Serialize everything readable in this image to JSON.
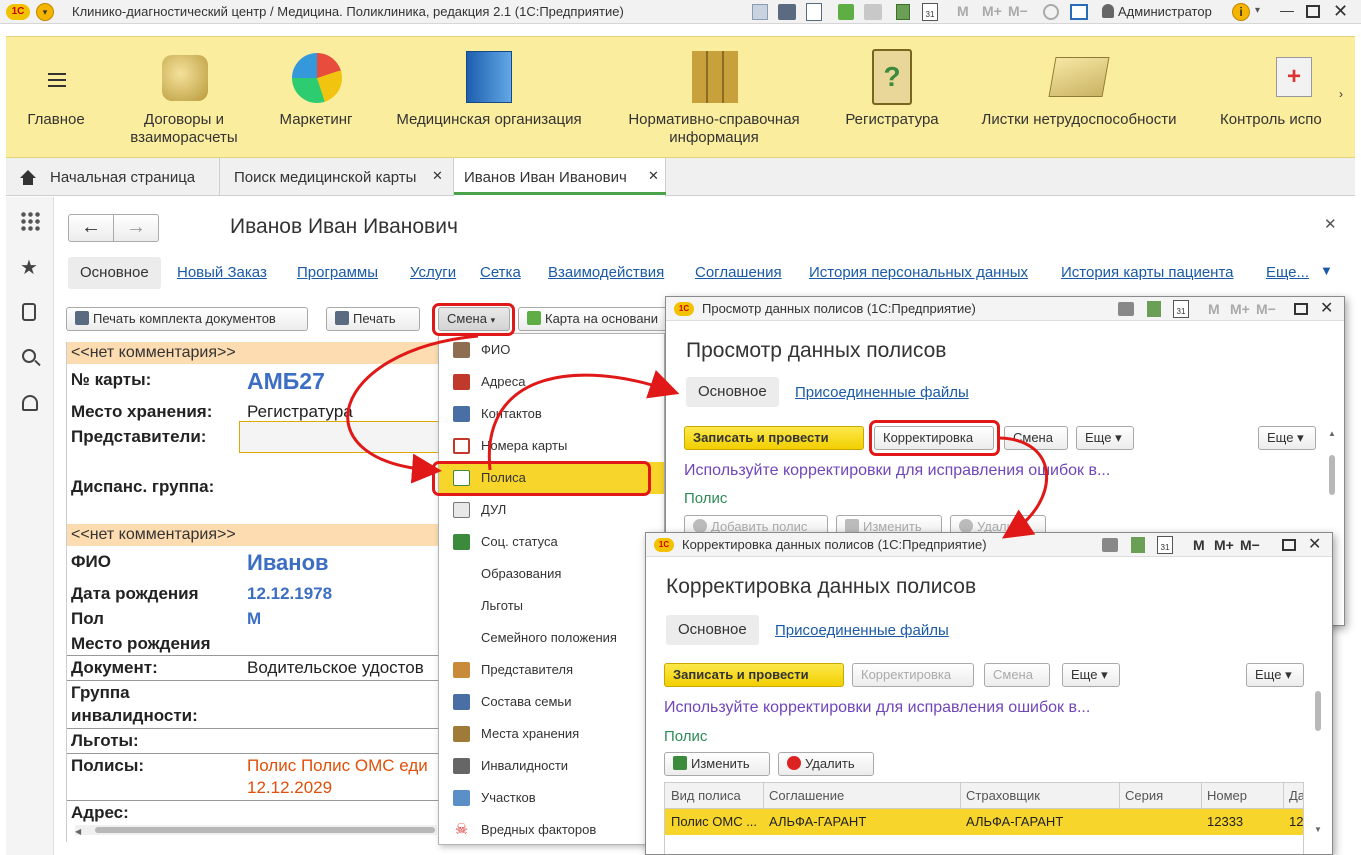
{
  "app": {
    "title": "Клинико-диагностический центр / Медицина. Поликлиника, редакция 2.1  (1С:Предприятие)",
    "user": "Администратор",
    "m_buttons": [
      "M",
      "M+",
      "M−"
    ]
  },
  "sections": [
    {
      "label": "Главное",
      "icon": "hamburger-icon"
    },
    {
      "label": "Договоры и взаиморасчеты",
      "icon": "coins-icon"
    },
    {
      "label": "Маркетинг",
      "icon": "pie-chart-icon"
    },
    {
      "label": "Медицинская организация",
      "icon": "building-icon"
    },
    {
      "label": "Нормативно-справочная информация",
      "icon": "binders-icon"
    },
    {
      "label": "Регистратура",
      "icon": "clipboard-question-icon"
    },
    {
      "label": "Листки нетрудоспособности",
      "icon": "documents-icon"
    },
    {
      "label": "Контроль испо",
      "icon": "first-aid-icon"
    }
  ],
  "open_tabs": [
    {
      "label": "Начальная страница"
    },
    {
      "label": "Поиск медицинской карты"
    },
    {
      "label": "Иванов Иван Иванович"
    }
  ],
  "patient_form": {
    "title": "Иванов Иван Иванович",
    "nav_links": [
      "Основное",
      "Новый Заказ",
      "Программы",
      "Услуги",
      "Сетка",
      "Взаимодействия",
      "Соглашения",
      "История персональных данных",
      "История карты пациента",
      "Еще..."
    ],
    "buttons": {
      "print_set": "Печать комплекта документов",
      "print": "Печать",
      "change": "Смена",
      "card_basis": "Карта на основани"
    },
    "comment_1": "<<нет комментария>>",
    "comment_2": "<<нет комментария>>",
    "fields": {
      "card_no_label": "№ карты:",
      "card_no": "АМБ27",
      "storage_label": "Место хранения:",
      "storage": "Регистратура",
      "reps_label": "Представители:",
      "disp_label": "Диспанс. группа:",
      "fio_label": "ФИО",
      "fio": "Иванов",
      "dob_label": "Дата рождения",
      "dob": "12.12.1978",
      "sex_label": "Пол",
      "sex": "М",
      "pob_label": "Место рождения",
      "doc_label": "Документ:",
      "doc": "Водительское удостов",
      "disab_label_1": "Группа",
      "disab_label_2": "инвалидности:",
      "benefits_label": "Льготы:",
      "policies_label": "Полисы:",
      "policies_1": "Полис Полис ОМС еди",
      "policies_2": "12.12.2029",
      "address_label": "Адрес:"
    }
  },
  "change_menu": [
    "ФИО",
    "Адреса",
    "Контактов",
    "Номера карты",
    "Полиса",
    "ДУЛ",
    "Соц. статуса",
    "Образования",
    "Льготы",
    "Семейного положения",
    "Представителя",
    "Состава семьи",
    "Места хранения",
    "Инвалидности",
    "Участков",
    "Вредных факторов"
  ],
  "view_window": {
    "title": "Просмотр данных полисов  (1С:Предприятие)",
    "heading": "Просмотр данных полисов",
    "tab_main": "Основное",
    "tab_files": "Присоединенные файлы",
    "btn_post": "Записать и провести",
    "btn_correct": "Корректировка",
    "btn_change": "Смена",
    "btn_more": "Еще",
    "btn_more2": "Еще",
    "hint": "Используйте корректировки для исправления ошибок в...",
    "section": "Полис",
    "btn_add": "Добавить полис",
    "btn_edit": "Изменить",
    "btn_delete": "Удалить"
  },
  "correct_window": {
    "title": "Корректировка данных полисов  (1С:Предприятие)",
    "heading": "Корректировка данных полисов",
    "tab_main": "Основное",
    "tab_files": "Присоединенные файлы",
    "btn_post": "Записать и провести",
    "btn_correct": "Корректировка",
    "btn_change": "Смена",
    "btn_more": "Еще",
    "btn_more2": "Еще",
    "hint": "Используйте корректировки для исправления ошибок в...",
    "section": "Полис",
    "btn_edit": "Изменить",
    "btn_delete": "Удалить",
    "table": {
      "columns": [
        "Вид полиса",
        "Соглашение",
        "Страховщик",
        "Серия",
        "Номер",
        "Да"
      ],
      "rows": [
        [
          "Полис ОМС ...",
          "АЛЬФА-ГАРАНТ",
          "АЛЬФА-ГАРАНТ",
          "",
          "12333",
          "12"
        ]
      ]
    }
  },
  "colors": {
    "section_bar": "#fbed9e",
    "accent_yellow": "#f7d52a",
    "annotation_red": "#e01818",
    "link_blue": "#1a5aa6",
    "hint_purple": "#7046b8",
    "section_green": "#2e8b57"
  }
}
